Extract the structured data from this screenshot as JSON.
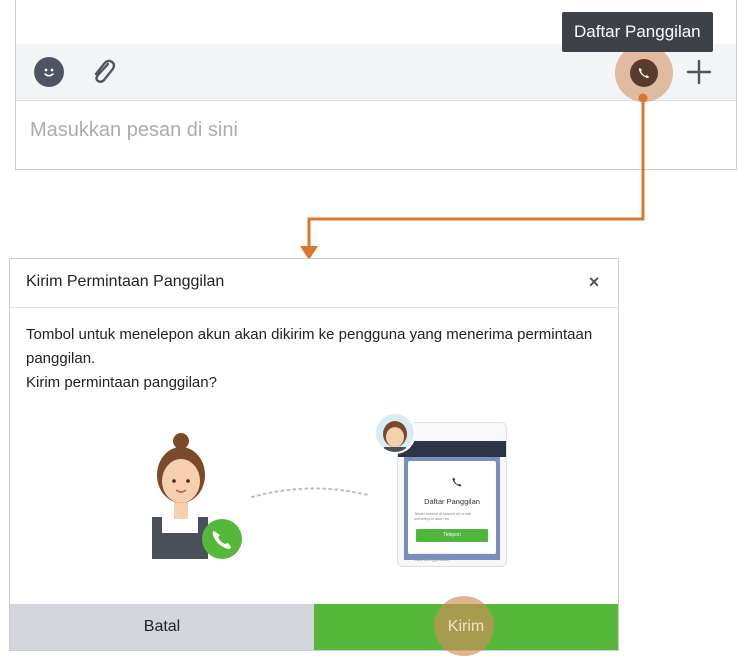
{
  "composer": {
    "placeholder": "Masukkan pesan di sini",
    "tooltip": "Daftar Panggilan",
    "icons": [
      "emoji-icon",
      "paperclip-icon",
      "call-icon",
      "plus-icon"
    ]
  },
  "connector_color": "#d9782d",
  "modal": {
    "title": "Kirim Permintaan Panggilan",
    "close_label": "×",
    "body_line1": "Tombol untuk menelepon akun akan dikirim ke pengguna yang menerima permintaan panggilan.",
    "body_line2": "Kirim permintaan panggilan?",
    "phone": {
      "header_text": "< Kembali",
      "card_title": "Daftar Panggilan",
      "card_text": "Tekan tombol di bawah ini untuk menelepon akun ini.",
      "card_button": "Telepon",
      "card_link": "Cara Menggunakan"
    },
    "cancel_label": "Batal",
    "send_label": "Kirim"
  },
  "colors": {
    "accent_green": "#55b83a",
    "highlight": "#d28c5a",
    "tooltip_bg": "#3d4148"
  }
}
